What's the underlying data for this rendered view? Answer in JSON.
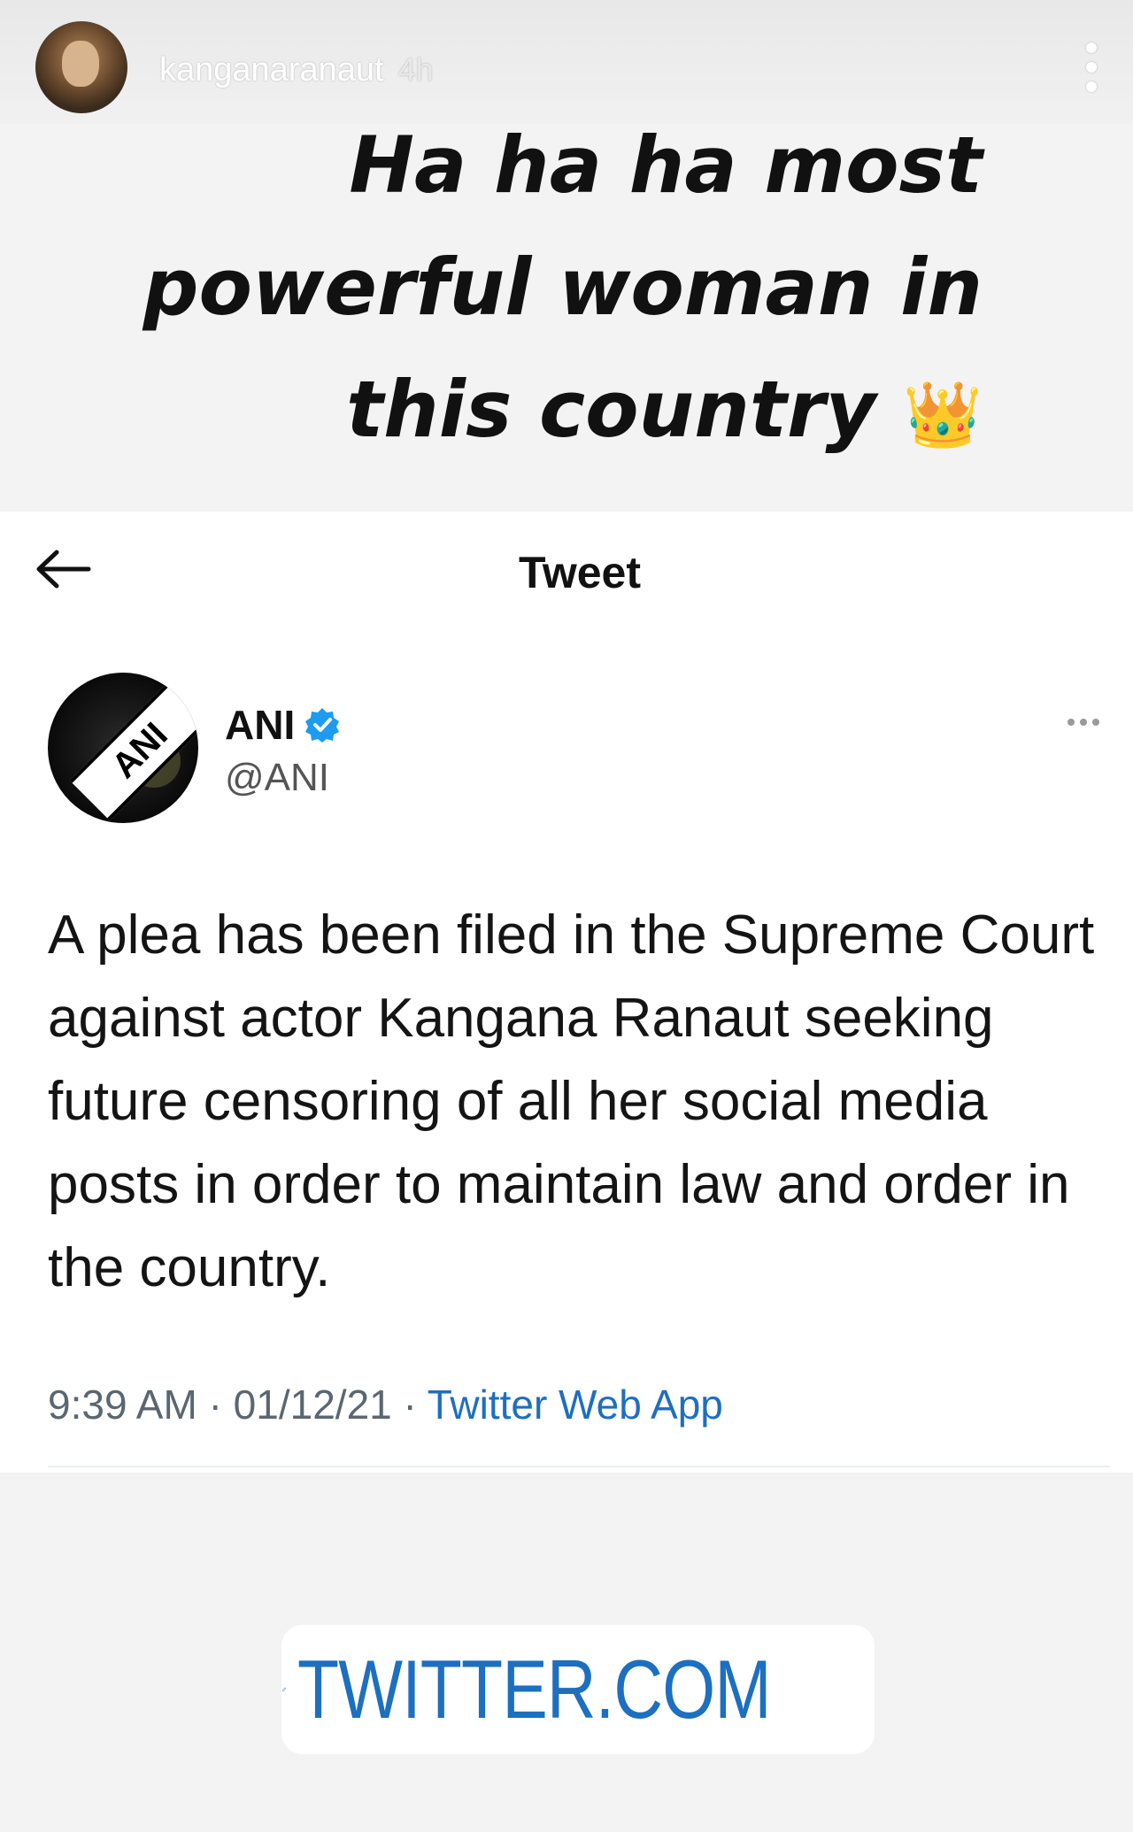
{
  "story": {
    "username": "kanganaranaut",
    "time": "4h"
  },
  "caption": {
    "line1": "Ha ha ha most",
    "line2": "powerful woman in",
    "line3": "this country",
    "emoji": "👑"
  },
  "tweet_screen": {
    "title": "Tweet",
    "author_name": "ANI",
    "author_handle": "@ANI",
    "logo_text": "ANI",
    "verified": true,
    "text": "A plea has been filed in the Supreme Court against actor Kangana Ranaut seeking future censoring of all her social media posts in order to maintain law and order in the country.",
    "time": "9:39 AM",
    "date": "01/12/21",
    "source": "Twitter Web App",
    "separator": "·"
  },
  "link_sticker": {
    "label": "TWITTER.COM",
    "icon": "link-icon"
  },
  "colors": {
    "link_blue": "#1d6fbf",
    "verified_blue": "#1d9bf0",
    "background": "#f3f3f3"
  }
}
